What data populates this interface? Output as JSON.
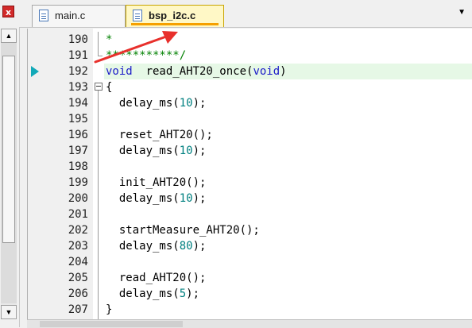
{
  "window": {
    "close_glyph": "x",
    "tab_dropdown_glyph": "▼"
  },
  "tabs": [
    {
      "label": "main.c",
      "active": false
    },
    {
      "label": "bsp_i2c.c",
      "active": true
    }
  ],
  "colors": {
    "keyword": "#1a1ac8",
    "number": "#008080",
    "comment": "#008000",
    "current_line": "#e6f8e6",
    "annotation_arrow": "#e8302c",
    "active_tab_underline": "#f5a000"
  },
  "editor": {
    "lines": [
      {
        "num": "190",
        "code": "*"
      },
      {
        "num": "191",
        "code": "***********/"
      },
      {
        "num": "192",
        "code": "void  read_AHT20_once(void)"
      },
      {
        "num": "193",
        "code": "{"
      },
      {
        "num": "194",
        "code": "  delay_ms(10);"
      },
      {
        "num": "195",
        "code": ""
      },
      {
        "num": "196",
        "code": "  reset_AHT20();"
      },
      {
        "num": "197",
        "code": "  delay_ms(10);"
      },
      {
        "num": "198",
        "code": ""
      },
      {
        "num": "199",
        "code": "  init_AHT20();"
      },
      {
        "num": "200",
        "code": "  delay_ms(10);"
      },
      {
        "num": "201",
        "code": ""
      },
      {
        "num": "202",
        "code": "  startMeasure_AHT20();"
      },
      {
        "num": "203",
        "code": "  delay_ms(80);"
      },
      {
        "num": "204",
        "code": ""
      },
      {
        "num": "205",
        "code": "  read_AHT20();"
      },
      {
        "num": "206",
        "code": "  delay_ms(5);"
      },
      {
        "num": "207",
        "code": "}"
      }
    ],
    "current_line_num": "192"
  },
  "icons": {
    "close": "close-icon",
    "file": "file-icon",
    "execution_arrow": "execution-arrow-icon",
    "fold": "fold-collapse-icon",
    "scroll_up": "scroll-up-icon",
    "scroll_down": "scroll-down-icon"
  }
}
